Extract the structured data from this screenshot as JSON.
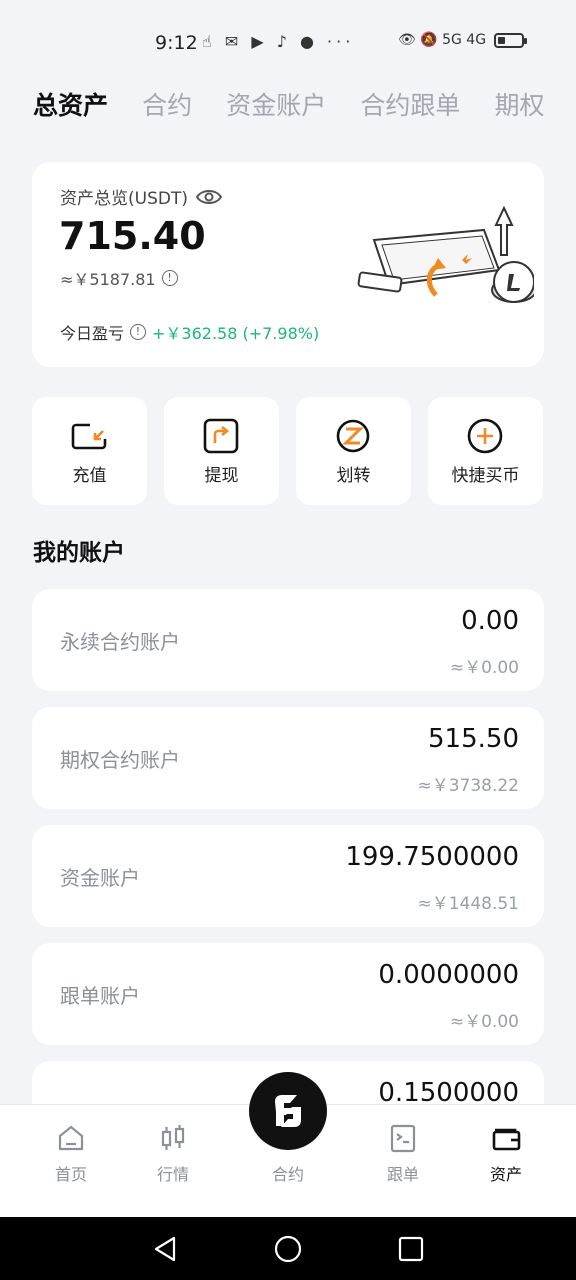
{
  "status_bar": {
    "time": "9:12",
    "left_icons": "☝ ✉ ▶ ♪ ● ···",
    "right_icons": "👁 🔕 5G 4G"
  },
  "tabs": [
    "总资产",
    "合约",
    "资金账户",
    "合约跟单",
    "期权"
  ],
  "overview": {
    "label": "资产总览(USDT)",
    "total": "715.40",
    "cny": "≈￥5187.81",
    "pnl_label": "今日盈亏",
    "pnl_value": "+￥362.58 (+7.98%)"
  },
  "actions": [
    {
      "label": "充值",
      "icon": "deposit-icon"
    },
    {
      "label": "提现",
      "icon": "withdraw-icon"
    },
    {
      "label": "划转",
      "icon": "transfer-icon"
    },
    {
      "label": "快捷买币",
      "icon": "quick-buy-icon"
    }
  ],
  "section_title": "我的账户",
  "accounts": [
    {
      "name": "永续合约账户",
      "value": "0.00",
      "cny": "≈￥0.00"
    },
    {
      "name": "期权合约账户",
      "value": "515.50",
      "cny": "≈￥3738.22"
    },
    {
      "name": "资金账户",
      "value": "199.7500000",
      "cny": "≈￥1448.51"
    },
    {
      "name": "跟单账户",
      "value": "0.0000000",
      "cny": "≈￥0.00"
    },
    {
      "name": "",
      "value": "0.1500000",
      "cny": ""
    }
  ],
  "bottom_nav": [
    {
      "label": "首页",
      "icon": "home-icon"
    },
    {
      "label": "行情",
      "icon": "candlestick-icon"
    },
    {
      "label": "合约",
      "icon": "contract-logo-icon"
    },
    {
      "label": "跟单",
      "icon": "copy-trade-icon"
    },
    {
      "label": "资产",
      "icon": "wallet-icon"
    }
  ],
  "colors": {
    "accent": "#f08a24",
    "positive": "#1db67b",
    "background": "#f2f4f7"
  }
}
